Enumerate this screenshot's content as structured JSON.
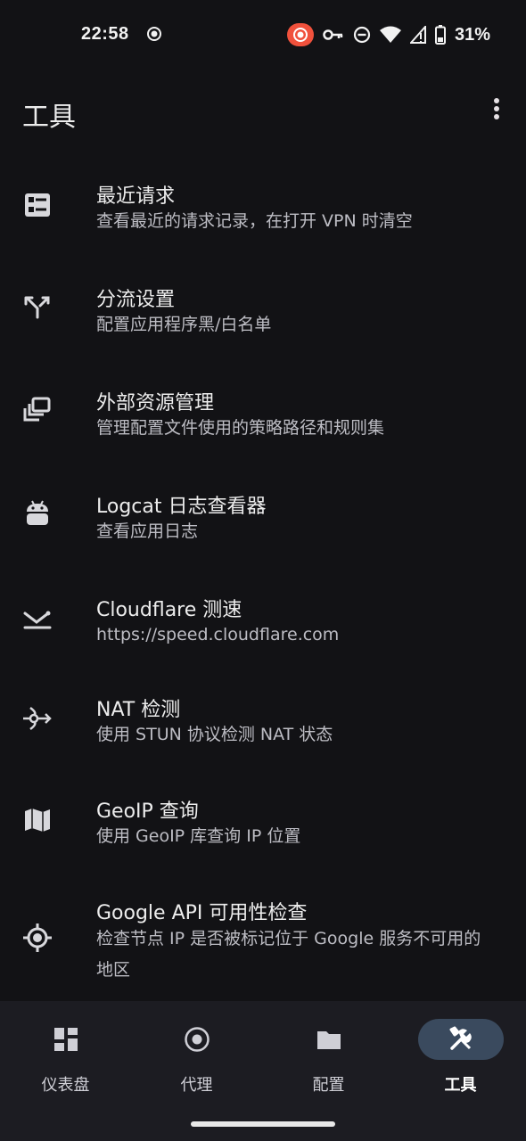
{
  "status": {
    "time": "22:58",
    "battery_pct": "31%",
    "icons": [
      "screen-record-icon",
      "vpn-key-icon",
      "do-not-disturb-icon",
      "wifi-icon",
      "signal-icon",
      "battery-icon"
    ],
    "rec_color": "#f0513c"
  },
  "app_bar": {
    "title": "工具",
    "more_icon": "more-vert-icon"
  },
  "items": [
    {
      "icon": "list-alt-icon",
      "title": "最近请求",
      "subtitle": "查看最近的请求记录，在打开 VPN 时清空"
    },
    {
      "icon": "call-split-icon",
      "title": "分流设置",
      "subtitle": "配置应用程序黑/白名单"
    },
    {
      "icon": "library-icon",
      "title": "外部资源管理",
      "subtitle": "管理配置文件使用的策略路径和规则集"
    },
    {
      "icon": "android-icon",
      "title": "Logcat 日志查看器",
      "subtitle": "查看应用日志"
    },
    {
      "icon": "speed-icon",
      "title": "Cloudflare 测速",
      "subtitle": "https://speed.cloudflare.com"
    },
    {
      "icon": "nat-icon",
      "title": "NAT 检测",
      "subtitle": "使用 STUN 协议检测 NAT 状态"
    },
    {
      "icon": "map-icon",
      "title": "GeoIP 查询",
      "subtitle": "使用 GeoIP 库查询 IP 位置"
    },
    {
      "icon": "gps-icon",
      "title": "Google API 可用性检查",
      "subtitle": "检查节点 IP 是否被标记位于 Google 服务不可用的地区"
    }
  ],
  "nav": [
    {
      "label": "仪表盘",
      "icon": "dashboard-icon",
      "active": false
    },
    {
      "label": "代理",
      "icon": "proxy-icon",
      "active": false
    },
    {
      "label": "配置",
      "icon": "folder-icon",
      "active": false
    },
    {
      "label": "工具",
      "icon": "tools-icon",
      "active": true
    }
  ],
  "colors": {
    "background": "#121215",
    "nav_background": "#1c1c22",
    "active_pill": "#3a4a5e"
  }
}
